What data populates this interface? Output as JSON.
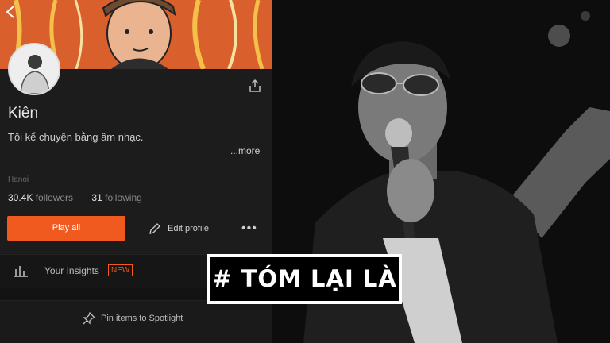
{
  "profile": {
    "name": "Kiên",
    "bio": "Tôi kể chuyện bằng âm nhạc.",
    "more_label": "...more",
    "location": "Hanoi",
    "followers_count": "30.4K",
    "followers_label": "followers",
    "following_count": "31",
    "following_label": "following"
  },
  "actions": {
    "play_all": "Play all",
    "edit_profile": "Edit profile",
    "more": "•••"
  },
  "insights": {
    "label": "Your Insights",
    "badge": "NEW"
  },
  "spotlight": {
    "label": "Pin items to Spotlight"
  },
  "overlay": {
    "title": "# TÓM LẠI LÀ"
  },
  "colors": {
    "accent": "#f05a1e",
    "banner": "#d9602c",
    "background": "#131313"
  },
  "icons": {
    "back": "back-chevron-icon",
    "share": "share-icon",
    "edit": "pencil-icon",
    "insights": "bar-chart-icon",
    "pin": "pin-icon"
  }
}
